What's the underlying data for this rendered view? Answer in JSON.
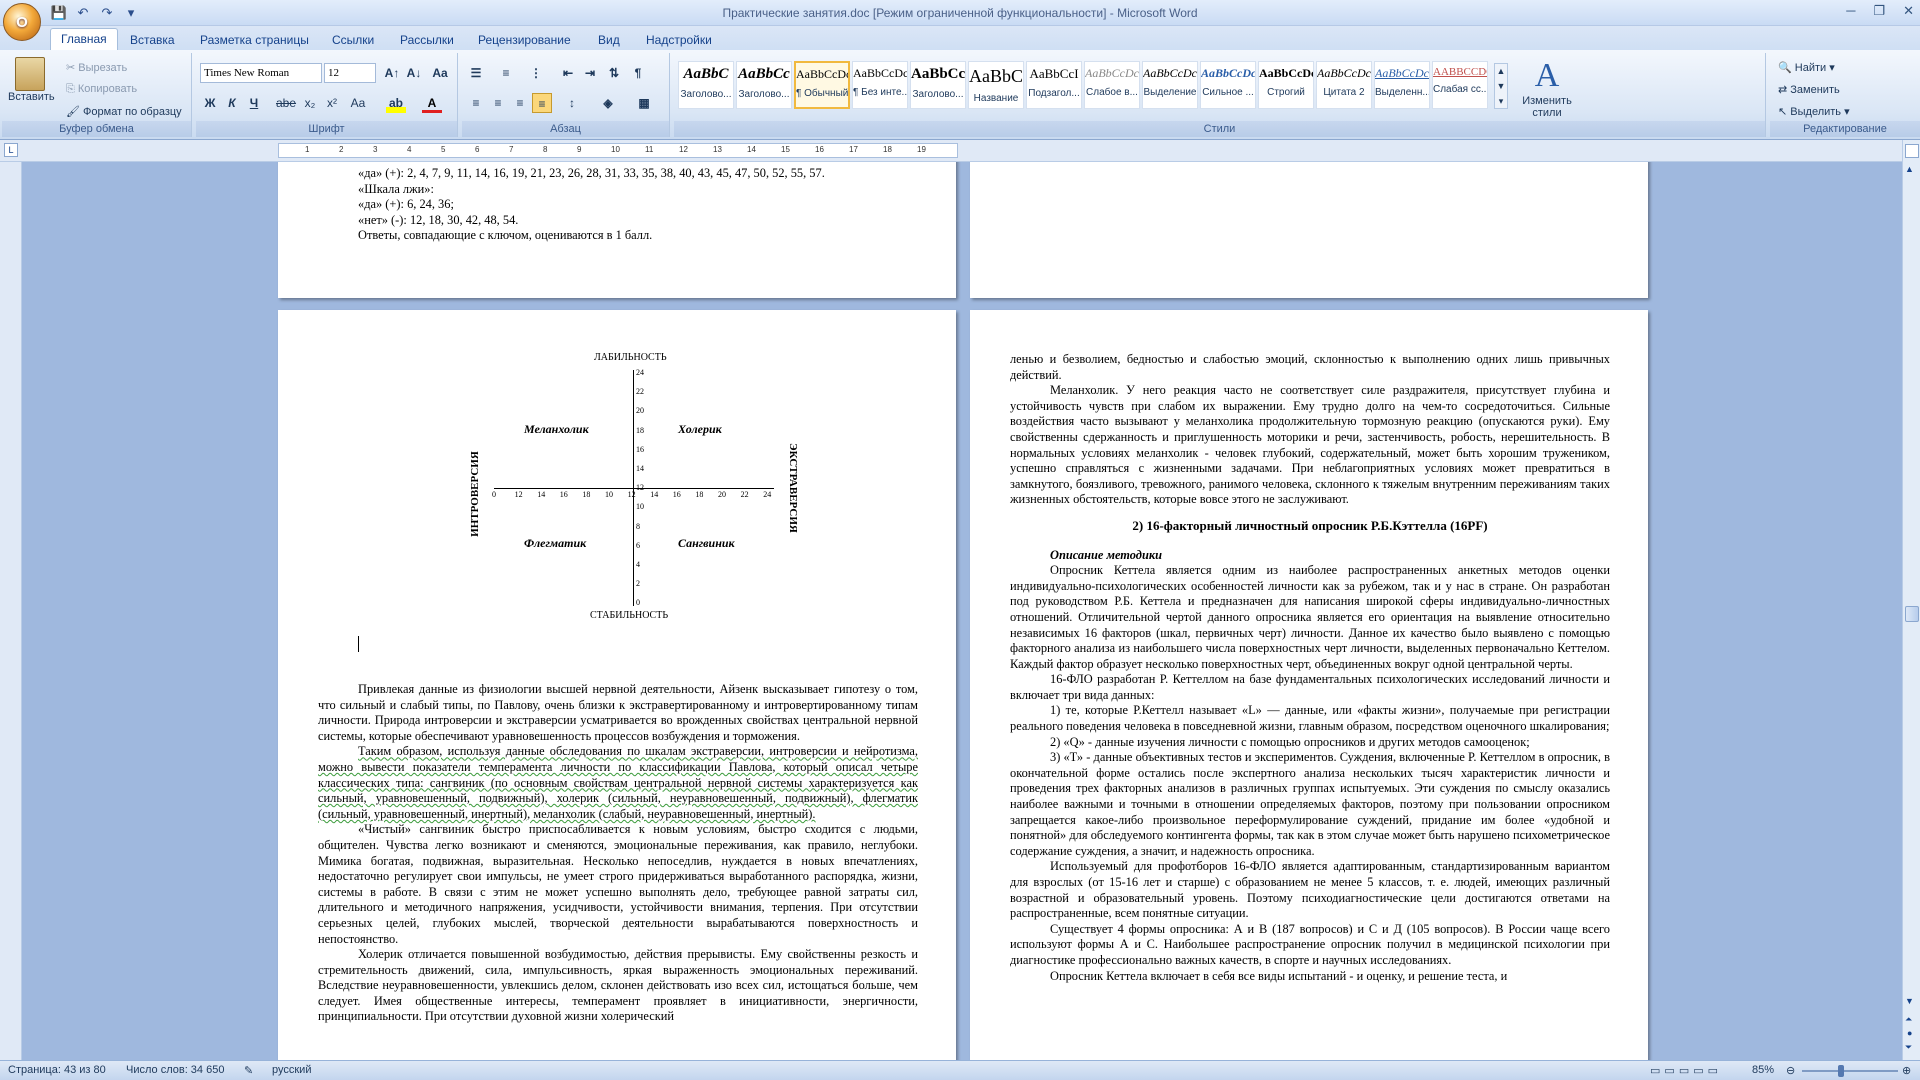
{
  "window": {
    "title": "Практические занятия.doc [Режим ограниченной функциональности] - Microsoft Word",
    "office_button": "O"
  },
  "tabs": [
    "Главная",
    "Вставка",
    "Разметка страницы",
    "Ссылки",
    "Рассылки",
    "Рецензирование",
    "Вид",
    "Надстройки"
  ],
  "active_tab": "Главная",
  "ribbon": {
    "clipboard": {
      "paste": "Вставить",
      "cut": "Вырезать",
      "copy": "Копировать",
      "format_painter": "Формат по образцу",
      "label": "Буфер обмена"
    },
    "font": {
      "name": "Times New Roman",
      "size": "12",
      "label": "Шрифт"
    },
    "paragraph": {
      "label": "Абзац"
    },
    "styles": {
      "label": "Стили",
      "items": [
        {
          "sample": "AaBbC",
          "name": "Заголово..."
        },
        {
          "sample": "AaBbCc",
          "name": "Заголово..."
        },
        {
          "sample": "AaBbCcDc",
          "name": "¶ Обычный"
        },
        {
          "sample": "AaBbCcDc",
          "name": "¶ Без инте..."
        },
        {
          "sample": "AaBbCc",
          "name": "Заголово..."
        },
        {
          "sample": "AaBbC",
          "name": "Название"
        },
        {
          "sample": "AaBbCcI",
          "name": "Подзагол..."
        },
        {
          "sample": "AaBbCcDc",
          "name": "Слабое в..."
        },
        {
          "sample": "AaBbCcDc",
          "name": "Выделение"
        },
        {
          "sample": "AaBbCcDc",
          "name": "Сильное ..."
        },
        {
          "sample": "AaBbCcDc",
          "name": "Строгий"
        },
        {
          "sample": "AaBbCcDc",
          "name": "Цитата 2"
        },
        {
          "sample": "AaBbCcDc",
          "name": "Выделенн..."
        },
        {
          "sample": "AABBCCDC",
          "name": "Слабая сс..."
        }
      ],
      "change_styles": "Изменить стили"
    },
    "editing": {
      "find": "Найти",
      "replace": "Заменить",
      "select": "Выделить",
      "label": "Редактирование"
    }
  },
  "page_top_left": {
    "lines": [
      "«да» (+): 2, 4, 7, 9, 11, 14, 16, 19, 21, 23, 26, 28, 31, 33, 35, 38, 40, 43, 45, 47, 50, 52, 55, 57.",
      "«Шкала лжи»:",
      "«да» (+): 6, 24, 36;",
      "«нет» (-): 12, 18, 30, 42, 48, 54.",
      "Ответы, совпадающие с ключом, оцениваются в 1 балл."
    ]
  },
  "diagram": {
    "top": "ЛАБИЛЬНОСТЬ",
    "bottom": "СТАБИЛЬНОСТЬ",
    "left": "ИНТРОВЕРСИЯ",
    "right": "ЭКСТРАВЕРСИЯ",
    "q1": "Меланхолик",
    "q2": "Холерик",
    "q3": "Флегматик",
    "q4": "Сангвиник"
  },
  "page_left": {
    "paragraphs": [
      "Привлекая данные из физиологии высшей нервной деятельности, Айзенк высказывает гипотезу о том, что сильный и слабый типы, по Павлову, очень близки к экстравертированному и интровертированному типам личности. Природа интроверсии и экстраверсии усматривается во врожденных свойствах центральной нервной системы, которые обеспечивают уравновешенность процессов возбуждения и торможения.",
      "Таким образом, используя данные обследования по шкалам экстраверсии, интроверсии и нейротизма, можно вывести показатели темперамента личности по классификации Павлова, который описал четыре классических типа: сангвиник (по основным свойствам центральной нервной системы характеризуется как сильный, уравновешенный, подвижный), холерик (сильный, неуравновешенный, подвижный), флегматик (сильный, уравновешенный, инертный), меланхолик (слабый, неуравновешенный, инертный).",
      "«Чистый» сангвиник быстро приспосабливается к новым условиям, быстро сходится с людьми, общителен. Чувства легко возникают и сменяются, эмоциональные переживания, как правило, неглубоки. Мимика богатая, подвижная, выразительная. Несколько непоседлив, нуждается в новых впечатлениях, недостаточно регулирует свои импульсы, не умеет строго придерживаться выработанного распорядка, жизни, системы в работе. В связи с этим не может успешно выполнять дело, требующее равной затраты сил, длительного и методичного напряжения, усидчивости, устойчивости внимания, терпения. При отсутствии серьезных целей, глубоких мыслей, творческой деятельности вырабатываются поверхностность и непостоянство.",
      "Холерик отличается повышенной возбудимостью, действия прерывисты. Ему свойственны резкость и стремительность движений, сила, импульсивность, яркая выраженность эмоциональных переживаний. Вследствие неуравновешенности, увлекшись делом, склонен действовать изо всех сил, истощаться больше, чем следует. Имея общественные интересы, темперамент проявляет в инициативности, энергичности, принципиальности. При отсутствии духовной жизни холерический"
    ]
  },
  "page_right": {
    "intro": "ленью и безволием, бедностью и слабостью эмоций, склонностью к выполнению одних лишь привычных действий.",
    "melancholic": "Меланхолик. У него реакция часто не соответствует силе раздражителя, присутствует глубина и устойчивость чувств при слабом их выражении. Ему трудно долго на чем-то сосредоточиться. Сильные воздействия часто вызывают у меланхолика продолжительную тормозную реакцию (опускаются руки). Ему свойственны сдержанность и приглушенность моторики и речи, застенчивость, робость, нерешительность. В нормальных условиях меланхолик - человек глубокий, содержательный, может быть хорошим тружеником, успешно справляться с жизненными задачами. При неблагоприятных условиях может превратиться в замкнутого, боязливого, тревожного, ранимого человека, склонного к тяжелым внутренним переживаниям таких жизненных обстоятельств, которые вовсе этого не заслуживают.",
    "heading": "2) 16-факторный личностный опросник Р.Б.Кэттелла (16PF)",
    "subheading": "Описание методики",
    "p1": "Опросник Кеттела является одним из наиболее распространенных анкетных методов оценки индивидуально-психологических особенностей личности как за рубежом, так и у нас в стране. Он разработан под руководством Р.Б. Кеттела и предназначен для написания широкой сферы индивидуально-личностных отношений. Отличительной чертой данного опросника является его ориентация на выявление относительно независимых 16 факторов (шкал, первичных черт) личности. Данное их качество было выявлено с помощью факторного анализа из наибольшего числа поверхностных черт личности, выделенных первоначально Кеттелом. Каждый фактор образует несколько поверхностных черт, объединенных вокруг одной центральной черты.",
    "p2": "16-ФЛО разработан Р. Кеттеллом на базе фундаментальных психологических исследований личности и включает три вида данных:",
    "p3": "1) те, которые Р.Кеттелл называет «L» — данные, или «факты жизни», получаемые при регистрации реального поведения человека в повседневной жизни, главным образом, посредством оценочного шкалирования;",
    "p4": "2) «Q» - данные изучения личности с помощью опросников и других методов самооценок;",
    "p5": "3) «Т» - данные объективных тестов и экспериментов. Суждения, включенные Р. Кеттеллом в опросник, в окончательной форме остались после экспертного анализа нескольких тысяч характеристик личности и проведения трех факторных анализов в различных группах испытуемых. Эти суждения по смыслу оказались наиболее важными и точными в отношении определяемых факторов, поэтому при пользовании опросником запрещается какое-либо произвольное переформулирование суждений, придание им более «удобной и понятной» для обследуемого контингента формы, так как в этом случае может быть нарушено психометрическое содержание суждения, а значит, и надежность опросника.",
    "p6": "Используемый для профотборов 16-ФЛО является адаптированным, стандартизированным вариантом для взрослых (от 15-16 лет и старше) с образованием не менее 5 классов, т. е. людей, имеющих различный возрастной и образовательный уровень. Поэтому психодиагностические цели достигаются ответами на распространенные, всем понятные ситуации.",
    "p7": "Существует 4 формы опросника: А и В (187 вопросов) и С и Д (105 вопросов). В России чаще всего используют формы А и С. Наибольшее распространение опросник получил в медицинской психологии при диагностике профессионально важных качеств, в спорте и научных исследованиях.",
    "p8": "Опросник Кеттела включает в себя все виды испытаний - и оценку, и решение теста, и"
  },
  "status": {
    "page": "Страница: 43 из 80",
    "words": "Число слов: 34 650",
    "lang": "русский",
    "zoom": "85%"
  }
}
